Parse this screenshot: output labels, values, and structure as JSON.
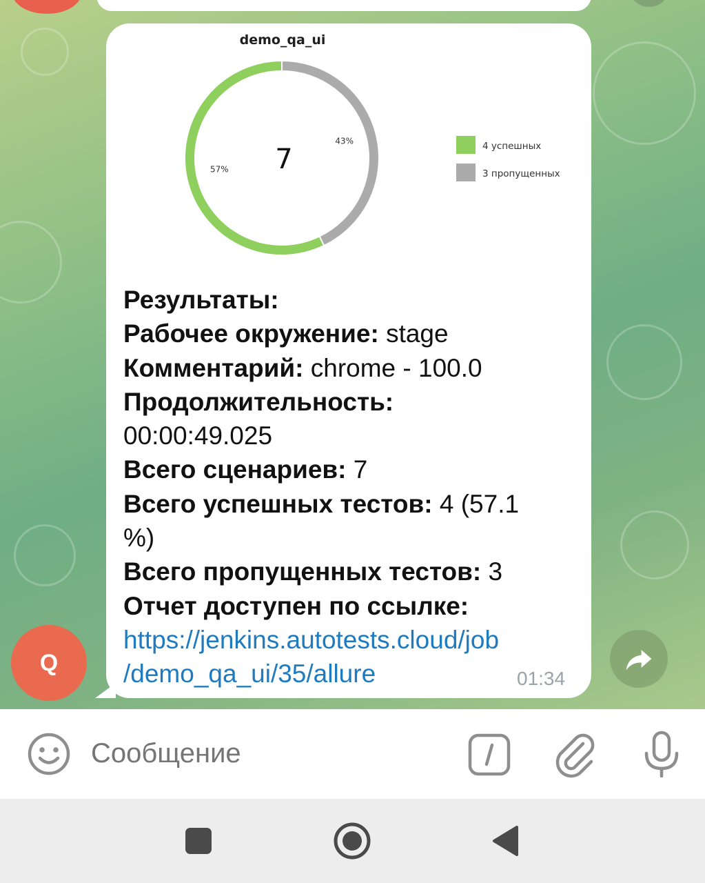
{
  "conversation": {
    "sender_initial": "Q",
    "message": {
      "chart_title": "demo_qa_ui",
      "chart_data": {
        "type": "pie",
        "title": "demo_qa_ui",
        "center_label": "7",
        "series": [
          {
            "name": "4 успешных",
            "value": 4,
            "percent_label": "57%",
            "color": "#8fcf5d"
          },
          {
            "name": "3 пропущенных",
            "value": 3,
            "percent_label": "43%",
            "color": "#ababab"
          }
        ],
        "legend_placement": "right"
      },
      "lines": [
        {
          "label": "Результаты:",
          "value": ""
        },
        {
          "label": "Рабочее окружение:",
          "value": " stage"
        },
        {
          "label": "Комментарий:",
          "value": " chrome - 100.0"
        },
        {
          "label": "Продолжительность:",
          "value": ""
        },
        {
          "label": "",
          "value": "00:00:49.025"
        },
        {
          "label": "Всего сценариев:",
          "value": " 7"
        },
        {
          "label": "Всего успешных тестов:",
          "value": " 4 (57.1"
        },
        {
          "label": "",
          "value": "%)"
        },
        {
          "label": "Всего пропущенных тестов:",
          "value": " 3"
        },
        {
          "label": "Отчет доступен по ссылке:",
          "value": ""
        }
      ],
      "link_line1": "https://jenkins.autotests.cloud/job",
      "link_line2": "/demo_qa_ui/35/allure",
      "time": "01:34"
    }
  },
  "input": {
    "placeholder": "Сообщение",
    "emoji_icon": "smile-icon",
    "commands_icon": "slash-command-icon",
    "attach_icon": "paperclip-icon",
    "mic_icon": "microphone-icon"
  },
  "colors": {
    "link": "#1f7bbf",
    "avatar": "#ea6a4f",
    "passed": "#8fcf5d",
    "skipped": "#ababab"
  }
}
